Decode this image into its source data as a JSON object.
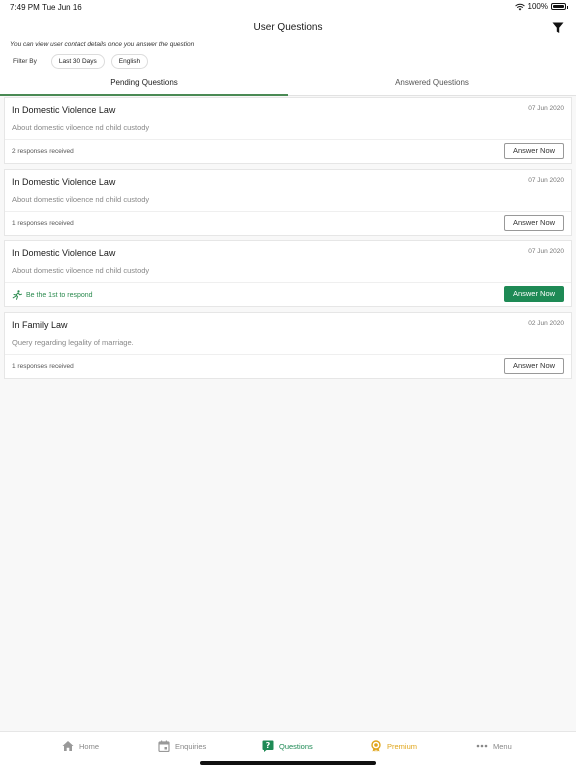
{
  "status_bar": {
    "time": "7:49 PM",
    "date": "Tue Jun 16",
    "battery": "100%"
  },
  "header": {
    "title": "User Questions",
    "info": "You can view user contact details once you answer the question",
    "filter_label": "Filter By",
    "filters": [
      "Last 30 Days",
      "English"
    ]
  },
  "tabs": {
    "pending": "Pending Questions",
    "answered": "Answered Questions"
  },
  "questions": [
    {
      "title": "In Domestic Violence Law",
      "date": "07 Jun 2020",
      "description": "About domestic viloence nd child custody",
      "status": "2 responses received",
      "button": "Answer Now"
    },
    {
      "title": "In Domestic Violence Law",
      "date": "07 Jun 2020",
      "description": "About domestic viloence nd child custody",
      "status": "1 responses received",
      "button": "Answer Now"
    },
    {
      "title": "In Domestic Violence Law",
      "date": "07 Jun 2020",
      "description": "About domestic viloence nd child custody",
      "status": "Be the 1st to respond",
      "button": "Answer Now"
    },
    {
      "title": "In Family Law",
      "date": "02 Jun 2020",
      "description": "Query regarding legality of marriage.",
      "status": "1 responses received",
      "button": "Answer Now"
    }
  ],
  "nav": {
    "home": "Home",
    "enquiries": "Enquiries",
    "questions": "Questions",
    "premium": "Premium",
    "menu": "Menu"
  },
  "colors": {
    "accent": "#1e8a55",
    "premium": "#e0a51a",
    "tab_underline": "#4a8a54"
  }
}
